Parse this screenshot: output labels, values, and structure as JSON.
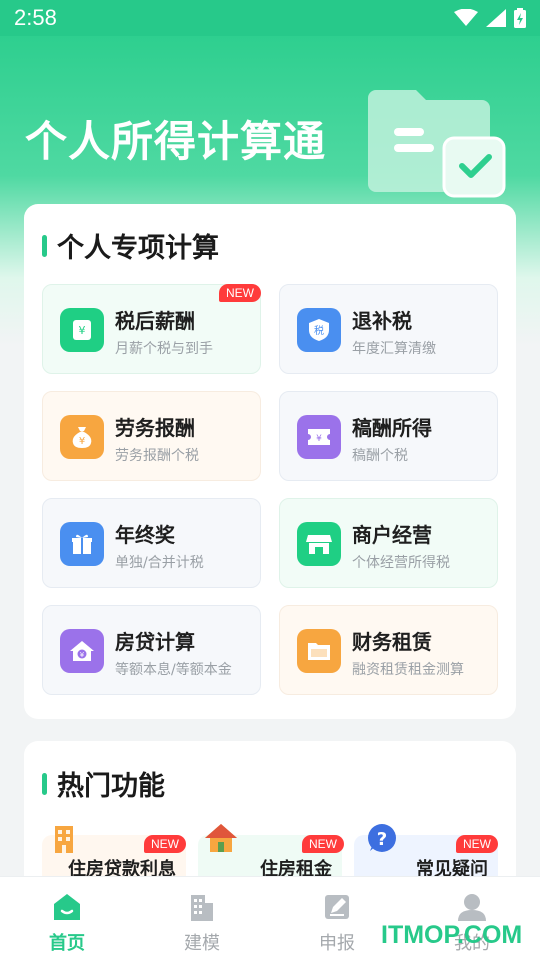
{
  "status": {
    "time": "2:58"
  },
  "hero": {
    "title": "个人所得计算通"
  },
  "section_main": {
    "title": "个人专项计算"
  },
  "tiles": [
    {
      "title": "税后薪酬",
      "subtitle": "月薪个税与到手",
      "icon": "salary-icon",
      "color": "#1fcf84",
      "badge": "NEW"
    },
    {
      "title": "退补税",
      "subtitle": "年度汇算清缴",
      "icon": "tax-shield-icon",
      "color": "#4a8ff0",
      "glyph": "税"
    },
    {
      "title": "劳务报酬",
      "subtitle": "劳务报酬个税",
      "icon": "money-bag-icon",
      "color": "#f7a640"
    },
    {
      "title": "稿酬所得",
      "subtitle": "稿酬个税",
      "icon": "ticket-icon",
      "color": "#9b72ea"
    },
    {
      "title": "年终奖",
      "subtitle": "单独/合并计税",
      "icon": "gift-icon",
      "color": "#4a8ff0"
    },
    {
      "title": "商户经营",
      "subtitle": "个体经营所得税",
      "icon": "store-icon",
      "color": "#1fcf84"
    },
    {
      "title": "房贷计算",
      "subtitle": "等额本息/等额本金",
      "icon": "house-loan-icon",
      "color": "#9b72ea"
    },
    {
      "title": "财务租赁",
      "subtitle": "融资租赁租金测算",
      "icon": "folder-icon",
      "color": "#f7a640"
    }
  ],
  "section_hot": {
    "title": "热门功能"
  },
  "hot_items": [
    {
      "label": "住房贷款利息",
      "icon": "building-icon",
      "badge": "NEW"
    },
    {
      "label": "住房租金",
      "icon": "home-icon",
      "badge": "NEW"
    },
    {
      "label": "常见疑问",
      "icon": "question-icon",
      "badge": "NEW"
    }
  ],
  "nav": [
    {
      "label": "首页",
      "icon": "home-nav-icon",
      "active": true
    },
    {
      "label": "建模",
      "icon": "buildings-nav-icon"
    },
    {
      "label": "申报",
      "icon": "edit-nav-icon"
    },
    {
      "label": "我的",
      "icon": "user-nav-icon"
    }
  ],
  "watermark": "ITMOP.COM",
  "colors": {
    "accent": "#27c98a",
    "badge": "#ff3b3b"
  }
}
